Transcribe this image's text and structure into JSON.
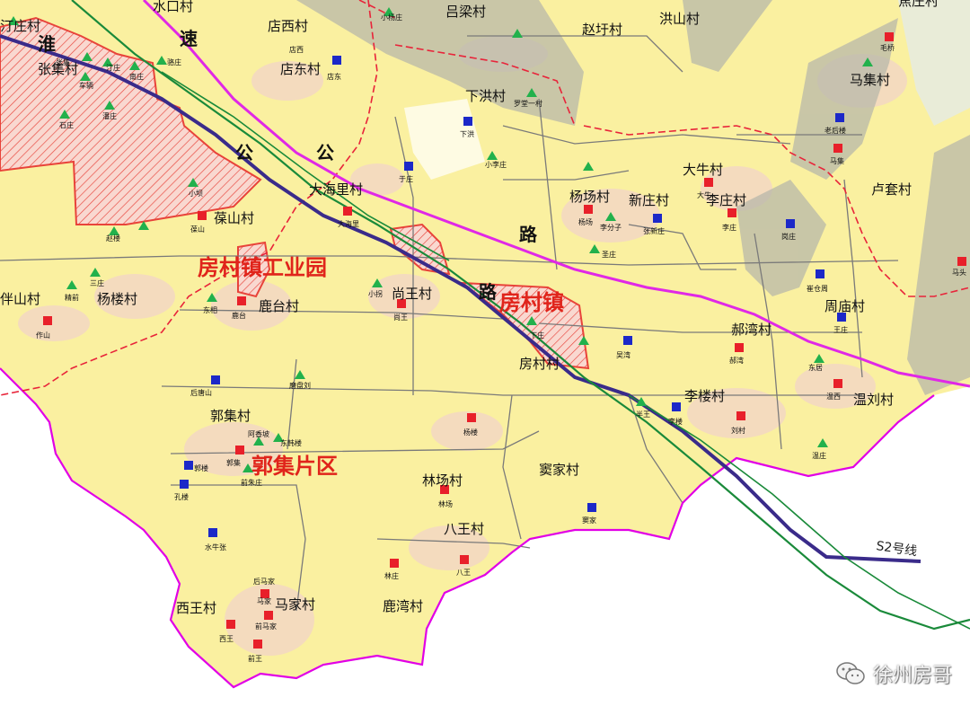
{
  "title": "",
  "colors": {
    "land": "#faf0a0",
    "boundary": "#e100e6",
    "highway": "#e028e6",
    "rail": "#1a8a3a",
    "expressway": "#3a2b8a",
    "urban_hatch": "#e8433a",
    "gray_band": "#b8b8aa",
    "village_red": "#e8202a",
    "village_blue": "#1c28c8",
    "village_green": "#22b14c"
  },
  "zone_labels": {
    "industrial_park": "房村镇工业园",
    "town": "房村镇",
    "guoji_area": "郭集片区"
  },
  "road_labels": {
    "huai": "淮",
    "su": "速",
    "gong1": "公",
    "gong2": "公",
    "lu1": "路",
    "lu2": "路",
    "s2": "S2号线"
  },
  "villages": {
    "shuikou": "水口村",
    "lvliang": "吕梁村",
    "zhaoyu": "赵圩村",
    "hongshan": "洪山村",
    "jiaoshan": "焦庄村",
    "dianxi": "店西村",
    "diandong": "店东村",
    "zhangji": "张集村",
    "tingzhuang": "汀庄村",
    "xiahong": "下洪村",
    "majiqi": "马集村",
    "daniu": "大牛村",
    "dahaili": "大海里村",
    "yangchang": "杨场村",
    "xinzhuang": "新庄村",
    "lizhuang": "李庄村",
    "lutao": "卢套村",
    "baoshan": "葆山村",
    "jieshan": "伴山村",
    "yanglou": "杨楼村",
    "lutai": "鹿台村",
    "shangwang": "尚王村",
    "zhoumiao": "周庙村",
    "haowan": "郝湾村",
    "fangcun": "房村村",
    "liloui": "李楼村",
    "wenliu": "温刘村",
    "guoji": "郭集村",
    "linchang": "林场村",
    "doujia": "窦家村",
    "bawang": "八王村",
    "xiwang": "西王村",
    "majia": "马家村",
    "luwan": "鹿湾村"
  },
  "sites": {
    "s01": "张集",
    "s02": "汀庄",
    "s03": "车辆",
    "s04": "南庄",
    "s05": "骆庄",
    "s06": "石庄",
    "s07": "潘庄",
    "s08": "店西",
    "s09": "店东",
    "s10": "小杨庄",
    "s11": "罗堂一村",
    "s12": "下洪",
    "s13": "小李庄",
    "s14": "毛桥",
    "s15": "老后楼",
    "s16": "马集",
    "s17": "于庄",
    "s18": "大海里",
    "s19": "葆山",
    "s20": "小坝",
    "s21": "杨场",
    "s22": "李分子",
    "s23": "张新庄",
    "s24": "大牛",
    "s25": "李庄",
    "s26": "岗庄",
    "s27": "圣庄",
    "s28": "赵楼",
    "s29": "三庄",
    "s30": "作山",
    "s31": "精前",
    "s32": "鹿台",
    "s33": "小拐",
    "s34": "尚王",
    "s35": "东相",
    "s36": "吴湾",
    "s37": "崔仓周",
    "s38": "王庄",
    "s39": "郝湾",
    "s40": "后唐山",
    "s41": "磨盘刘",
    "s42": "杨楼",
    "s43": "半王",
    "s44": "李楼",
    "s45": "刘村",
    "s46": "温西",
    "s47": "东居",
    "s48": "阿香坡",
    "s49": "东韩楼",
    "s50": "郭楼",
    "s51": "孔楼",
    "s52": "郭集",
    "s53": "前朱庄",
    "s54": "温庄",
    "s55": "林场",
    "s56": "窦家",
    "s57": "水牛张",
    "s58": "林庄",
    "s59": "八王",
    "s60": "后马家",
    "s61": "马家",
    "s62": "前马家",
    "s63": "西王",
    "s64": "前王",
    "s65": "下庄",
    "s66": "马头"
  },
  "watermark": {
    "text": "徐州房哥",
    "icon": "wechat-icon"
  }
}
